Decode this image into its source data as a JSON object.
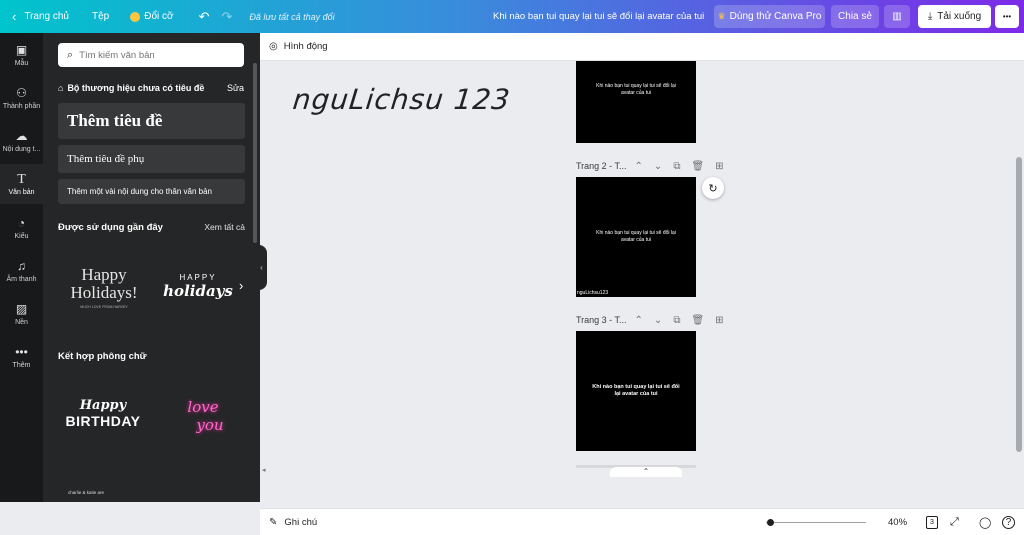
{
  "topbar": {
    "home": "Trang chủ",
    "file": "Tệp",
    "resize": "Đổi cỡ",
    "saved_status": "Đã lưu tất cả thay đổi",
    "design_title": "Khi nào bạn tui quay lại tui sẽ đổi lại avatar của tui",
    "try_pro": "Dùng thử Canva Pro",
    "share": "Chia sẻ",
    "download": "Tải xuống",
    "more": "•••"
  },
  "rail": [
    {
      "label": "Mẫu",
      "icon": "template-icon"
    },
    {
      "label": "Thành phần",
      "icon": "elements-icon"
    },
    {
      "label": "Nội dung t...",
      "icon": "upload-icon"
    },
    {
      "label": "Văn bản",
      "icon": "text-icon"
    },
    {
      "label": "Kiểu",
      "icon": "palette-icon"
    },
    {
      "label": "Âm thanh",
      "icon": "music-icon"
    },
    {
      "label": "Nền",
      "icon": "background-icon"
    },
    {
      "label": "Thêm",
      "icon": "more-icon"
    }
  ],
  "panel": {
    "search_placeholder": "Tìm kiếm văn bản",
    "brand_kit": "Bộ thương hiệu chưa có tiêu đề",
    "brand_edit": "Sửa",
    "add_heading": "Thêm tiêu đề",
    "add_subheading": "Thêm tiêu đề phụ",
    "add_body": "Thêm một vài nội dung cho thân văn bản",
    "recent_title": "Được sử dụng gần đây",
    "see_all": "Xem tất cả",
    "combo_title": "Kết hợp phông chữ",
    "font_samples": {
      "happy_holidays_1a": "Happy",
      "happy_holidays_1b": "Holidays!",
      "happy_holidays_1c": "MUCH LOVE FROM HARVEY",
      "happy_holidays_2a": "HAPPY",
      "happy_holidays_2b": "holidays",
      "birthday_a": "Happy",
      "birthday_b": "BIRTHDAY",
      "love_a": "love",
      "love_b": "you",
      "bottom_sample": "charlie & katie are"
    }
  },
  "editor": {
    "animate": "Hình động",
    "handwriting": "nguLichsu 123",
    "pages": [
      {
        "label": "Trang 2 - T...",
        "text": "Khi nào bạn tui quay lại tui sẽ đổi lại avatar của tui",
        "footer": "nguLichsu123"
      },
      {
        "label": "Trang 3 - T...",
        "text": "Khi nào bạn tui quay lại tui sẽ đổi lại avatar của tui"
      }
    ],
    "top_page_text": "Khi nào bạn tui quay lại tui sẽ đổi lại avatar của tui",
    "notes": "Ghi chú",
    "zoom": "40%",
    "page_count": "3",
    "zoom_fraction": 0.4
  }
}
